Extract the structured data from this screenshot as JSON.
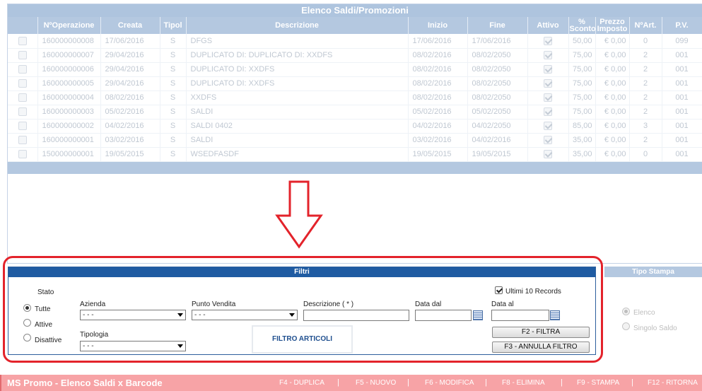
{
  "list": {
    "title": "Elenco Saldi/Promozioni",
    "columns": [
      "",
      "NºOperazione",
      "Creata",
      "Tipol",
      "Descrizione",
      "Inizio",
      "Fine",
      "Attivo",
      "% Sconto",
      "Prezzo Imposto",
      "NºArt.",
      "P.V."
    ],
    "rows": [
      {
        "op": "160000000008",
        "creata": "17/06/2016",
        "tipol": "S",
        "descr": "DFGS",
        "inizio": "17/06/2016",
        "fine": "17/06/2016",
        "attivo": true,
        "sconto": "50,00",
        "prezzo": "€ 0,00",
        "nart": "0",
        "pv": "099"
      },
      {
        "op": "160000000007",
        "creata": "29/04/2016",
        "tipol": "S",
        "descr": "DUPLICATO DI: DUPLICATO DI: XXDFS",
        "inizio": "08/02/2016",
        "fine": "08/02/2050",
        "attivo": true,
        "sconto": "75,00",
        "prezzo": "€ 0,00",
        "nart": "2",
        "pv": "001"
      },
      {
        "op": "160000000006",
        "creata": "29/04/2016",
        "tipol": "S",
        "descr": "DUPLICATO DI: XXDFS",
        "inizio": "08/02/2016",
        "fine": "08/02/2050",
        "attivo": true,
        "sconto": "75,00",
        "prezzo": "€ 0,00",
        "nart": "2",
        "pv": "001"
      },
      {
        "op": "160000000005",
        "creata": "29/04/2016",
        "tipol": "S",
        "descr": "DUPLICATO DI: XXDFS",
        "inizio": "08/02/2016",
        "fine": "08/02/2050",
        "attivo": true,
        "sconto": "75,00",
        "prezzo": "€ 0,00",
        "nart": "2",
        "pv": "001"
      },
      {
        "op": "160000000004",
        "creata": "08/02/2016",
        "tipol": "S",
        "descr": "XXDFS",
        "inizio": "08/02/2016",
        "fine": "08/02/2050",
        "attivo": true,
        "sconto": "75,00",
        "prezzo": "€ 0,00",
        "nart": "2",
        "pv": "001"
      },
      {
        "op": "160000000003",
        "creata": "05/02/2016",
        "tipol": "S",
        "descr": "SALDI",
        "inizio": "05/02/2016",
        "fine": "05/02/2050",
        "attivo": true,
        "sconto": "75,00",
        "prezzo": "€ 0,00",
        "nart": "2",
        "pv": "001"
      },
      {
        "op": "160000000002",
        "creata": "04/02/2016",
        "tipol": "S",
        "descr": "SALDI 0402",
        "inizio": "04/02/2016",
        "fine": "04/02/2050",
        "attivo": true,
        "sconto": "85,00",
        "prezzo": "€ 0,00",
        "nart": "3",
        "pv": "001"
      },
      {
        "op": "160000000001",
        "creata": "03/02/2016",
        "tipol": "S",
        "descr": "SALDI",
        "inizio": "03/02/2016",
        "fine": "04/02/2016",
        "attivo": true,
        "sconto": "35,00",
        "prezzo": "€ 0,00",
        "nart": "2",
        "pv": "001"
      },
      {
        "op": "150000000001",
        "creata": "19/05/2015",
        "tipol": "S",
        "descr": "WSEDFASDF",
        "inizio": "19/05/2015",
        "fine": "19/05/2015",
        "attivo": true,
        "sconto": "35,00",
        "prezzo": "€ 0,00",
        "nart": "0",
        "pv": "001"
      }
    ]
  },
  "filters": {
    "title": "Filtri",
    "stato_label": "Stato",
    "stato_options": [
      "Tutte",
      "Attive",
      "Disattive"
    ],
    "stato_selected": "Tutte",
    "azienda_label": "Azienda",
    "azienda_value": "- - -",
    "punto_vendita_label": "Punto Vendita",
    "punto_vendita_value": "- - -",
    "descrizione_label": "Descrizione ( * )",
    "descrizione_value": "",
    "data_dal_label": "Data dal",
    "data_al_label": "Data al",
    "tipologia_label": "Tipologia",
    "tipologia_value": "- - -",
    "ultimi_label": "Ultimi 10 Records",
    "ultimi_checked": true,
    "filtro_articoli": "FILTRO ARTICOLI",
    "filtra_button": "F2 - FILTRA",
    "annulla_button": "F3 - ANNULLA FILTRO"
  },
  "tipo_stampa": {
    "title": "Tipo Stampa",
    "options": [
      "Elenco",
      "Singolo Saldo"
    ],
    "selected": "Elenco"
  },
  "bottom_bar": {
    "app_title": "MS Promo - Elenco Saldi x Barcode",
    "keys": [
      "F4 - DUPLICA",
      "F5 - NUOVO",
      "F6 - MODIFICA",
      "F8 - ELIMINA",
      "F9 - STAMPA",
      "F12 - RITORNA"
    ],
    "separator": "|"
  },
  "colors": {
    "highlight": "#e3232b",
    "filter_header": "#1f5ba2",
    "bottom_bar": "#f7a3a6"
  }
}
